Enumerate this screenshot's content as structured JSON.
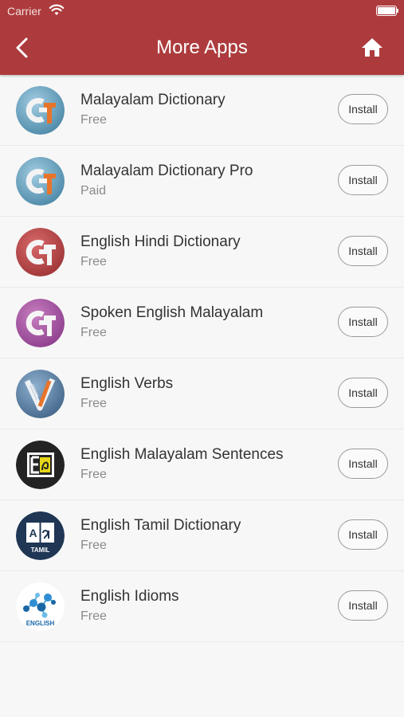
{
  "status_bar": {
    "carrier": "Carrier"
  },
  "header": {
    "title": "More Apps"
  },
  "apps": [
    {
      "name": "Malayalam Dictionary",
      "price": "Free",
      "button": "Install",
      "icon": "gt-logo-blue-icon"
    },
    {
      "name": "Malayalam Dictionary Pro",
      "price": "Paid",
      "button": "Install",
      "icon": "gt-logo-blue-icon"
    },
    {
      "name": "English Hindi Dictionary",
      "price": "Free",
      "button": "Install",
      "icon": "gt-logo-red-icon"
    },
    {
      "name": "Spoken English Malayalam",
      "price": "Free",
      "button": "Install",
      "icon": "gt-logo-purple-icon"
    },
    {
      "name": "English Verbs",
      "price": "Free",
      "button": "Install",
      "icon": "quill-pen-icon"
    },
    {
      "name": "English Malayalam Sentences",
      "price": "Free",
      "button": "Install",
      "icon": "e-malayalam-letter-icon"
    },
    {
      "name": "English Tamil Dictionary",
      "price": "Free",
      "button": "Install",
      "icon": "tamil-book-icon",
      "icon_label": "TAMIL"
    },
    {
      "name": "English Idioms",
      "price": "Free",
      "button": "Install",
      "icon": "idioms-molecule-icon",
      "icon_label": "ENGLISH"
    }
  ],
  "colors": {
    "header": "#ad3b3d",
    "background": "#f7f7f7"
  }
}
